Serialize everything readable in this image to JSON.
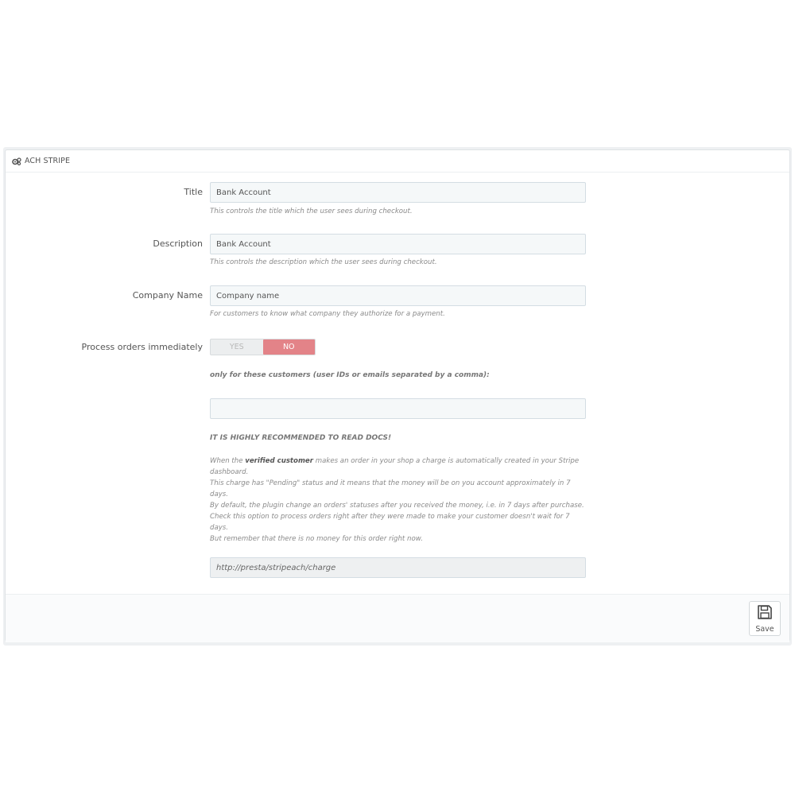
{
  "panel": {
    "title": "ACH STRIPE",
    "icon": "cogs-icon"
  },
  "fields": {
    "title": {
      "label": "Title",
      "value": "Bank Account",
      "help": "This controls the title which the user sees during checkout."
    },
    "description": {
      "label": "Description",
      "value": "Bank Account",
      "help": "This controls the description which the user sees during checkout."
    },
    "company_name": {
      "label": "Company Name",
      "value": "Company name",
      "help": "For customers to know what company they authorize for a payment."
    },
    "process_orders": {
      "label": "Process orders immediately",
      "yes_label": "YES",
      "no_label": "NO",
      "selected": "NO"
    },
    "customers": {
      "note": "only for these customers (user IDs or emails separated by a comma):",
      "value": ""
    }
  },
  "docs": {
    "warning": "IT IS HIGHLY RECOMMENDED TO READ DOCS!",
    "line1_pre": "When the ",
    "line1_bold": "verified customer",
    "line1_post": " makes an order in your shop a charge is automatically created in your Stripe dashboard.",
    "line2": "This charge has \"Pending\" status and it means that the money will be on you account approximately in 7 days.",
    "line3": "By default, the plugin change an orders' statuses after you received the money, i.e. in 7 days after purchase.",
    "line4": "Check this option to process orders right after they were made to make your customer doesn't wait for 7 days.",
    "line5": "But remember that there is no money for this order right now."
  },
  "webhook_url": "http://presta/stripeach/charge",
  "footer": {
    "save_label": "Save",
    "save_icon": "floppy-disk-icon"
  },
  "colors": {
    "no_active": "#e38388",
    "input_bg": "#f5f8f9",
    "border": "#d4dde3"
  }
}
